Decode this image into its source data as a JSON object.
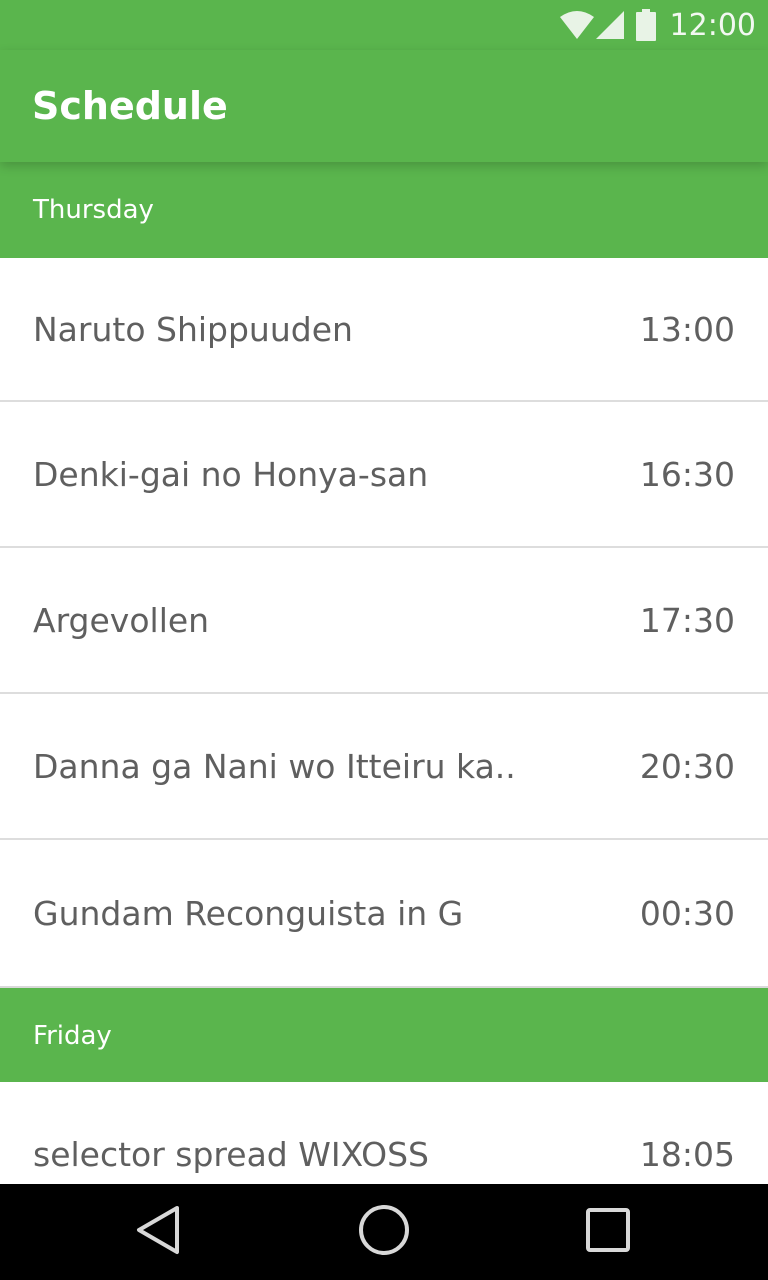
{
  "status": {
    "time": "12:00",
    "icons": [
      "wifi-icon",
      "signal-icon",
      "battery-icon"
    ]
  },
  "app_bar": {
    "title": "Schedule"
  },
  "days": [
    {
      "name": "Thursday",
      "shows": [
        {
          "title": "Naruto Shippuuden",
          "time": "13:00"
        },
        {
          "title": "Denki-gai no Honya-san",
          "time": "16:30"
        },
        {
          "title": "Argevollen",
          "time": "17:30"
        },
        {
          "title": "Danna ga Nani wo Itteiru ka..",
          "time": "20:30"
        },
        {
          "title": "Gundam Reconguista in G",
          "time": "00:30"
        }
      ]
    },
    {
      "name": "Friday",
      "shows": [
        {
          "title": "selector spread WIXOSS",
          "time": "18:05"
        }
      ]
    }
  ],
  "nav": {
    "icons": [
      "back-icon",
      "home-icon",
      "recents-icon"
    ]
  },
  "colors": {
    "primary": "#5ab54d",
    "text": "#5f5f5f",
    "divider": "#dddddd"
  }
}
